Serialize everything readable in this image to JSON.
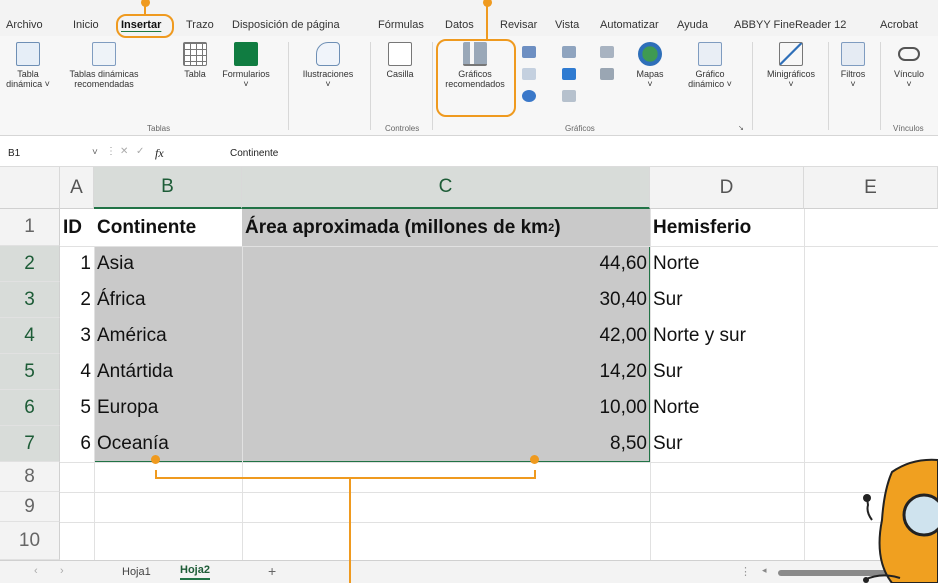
{
  "ribbon_tabs": [
    "Archivo",
    "Inicio",
    "Insertar",
    "Trazo",
    "Disposición de página",
    "Fórmulas",
    "Datos",
    "Revisar",
    "Vista",
    "Automatizar",
    "Ayuda",
    "ABBYY FineReader 12",
    "Acrobat"
  ],
  "active_tab": "Insertar",
  "ribbon": {
    "tables": {
      "pivot1": "Tabla",
      "pivot2": "dinámica ˅",
      "rec1": "Tablas dinámicas",
      "rec2": "recomendadas",
      "table": "Tabla",
      "forms": "Formularios",
      "group": "Tablas"
    },
    "illustrations": "Ilustraciones",
    "controls": {
      "checkbox": "Casilla",
      "group": "Controles"
    },
    "charts": {
      "rec1": "Gráficos",
      "rec2": "recomendados",
      "maps": "Mapas",
      "pivotchart1": "Gráfico",
      "pivotchart2": "dinámico ˅",
      "group": "Gráficos"
    },
    "sparklines": "Minigráficos",
    "filters": "Filtros",
    "links": {
      "link": "Vínculo",
      "group": "Vínculos"
    }
  },
  "formula_bar": {
    "name_box": "B1",
    "fx": "fx",
    "content": "Continente"
  },
  "columns": [
    "A",
    "B",
    "C",
    "D",
    "E"
  ],
  "rows": [
    "1",
    "2",
    "3",
    "4",
    "5",
    "6",
    "7",
    "8",
    "9",
    "10"
  ],
  "headers": {
    "id": "ID",
    "continent": "Continente",
    "area": "Área aproximada (millones de km",
    "area_sup": "2",
    "area_close": ")",
    "hemisphere": "Hemisferio"
  },
  "data_rows": [
    {
      "id": "1",
      "continent": "Asia",
      "area": "44,60",
      "hemisphere": "Norte"
    },
    {
      "id": "2",
      "continent": "África",
      "area": "30,40",
      "hemisphere": "Sur"
    },
    {
      "id": "3",
      "continent": "América",
      "area": "42,00",
      "hemisphere": "Norte y sur"
    },
    {
      "id": "4",
      "continent": "Antártida",
      "area": "14,20",
      "hemisphere": "Sur"
    },
    {
      "id": "5",
      "continent": "Europa",
      "area": "10,00",
      "hemisphere": "Norte"
    },
    {
      "id": "6",
      "continent": "Oceanía",
      "area": "8,50",
      "hemisphere": "Sur"
    }
  ],
  "sheets": [
    "Hoja1",
    "Hoja2"
  ],
  "active_sheet": "Hoja2",
  "colors": {
    "accent": "#ef9a1f",
    "excel_green": "#217346",
    "selection": "#c9c9c9"
  }
}
